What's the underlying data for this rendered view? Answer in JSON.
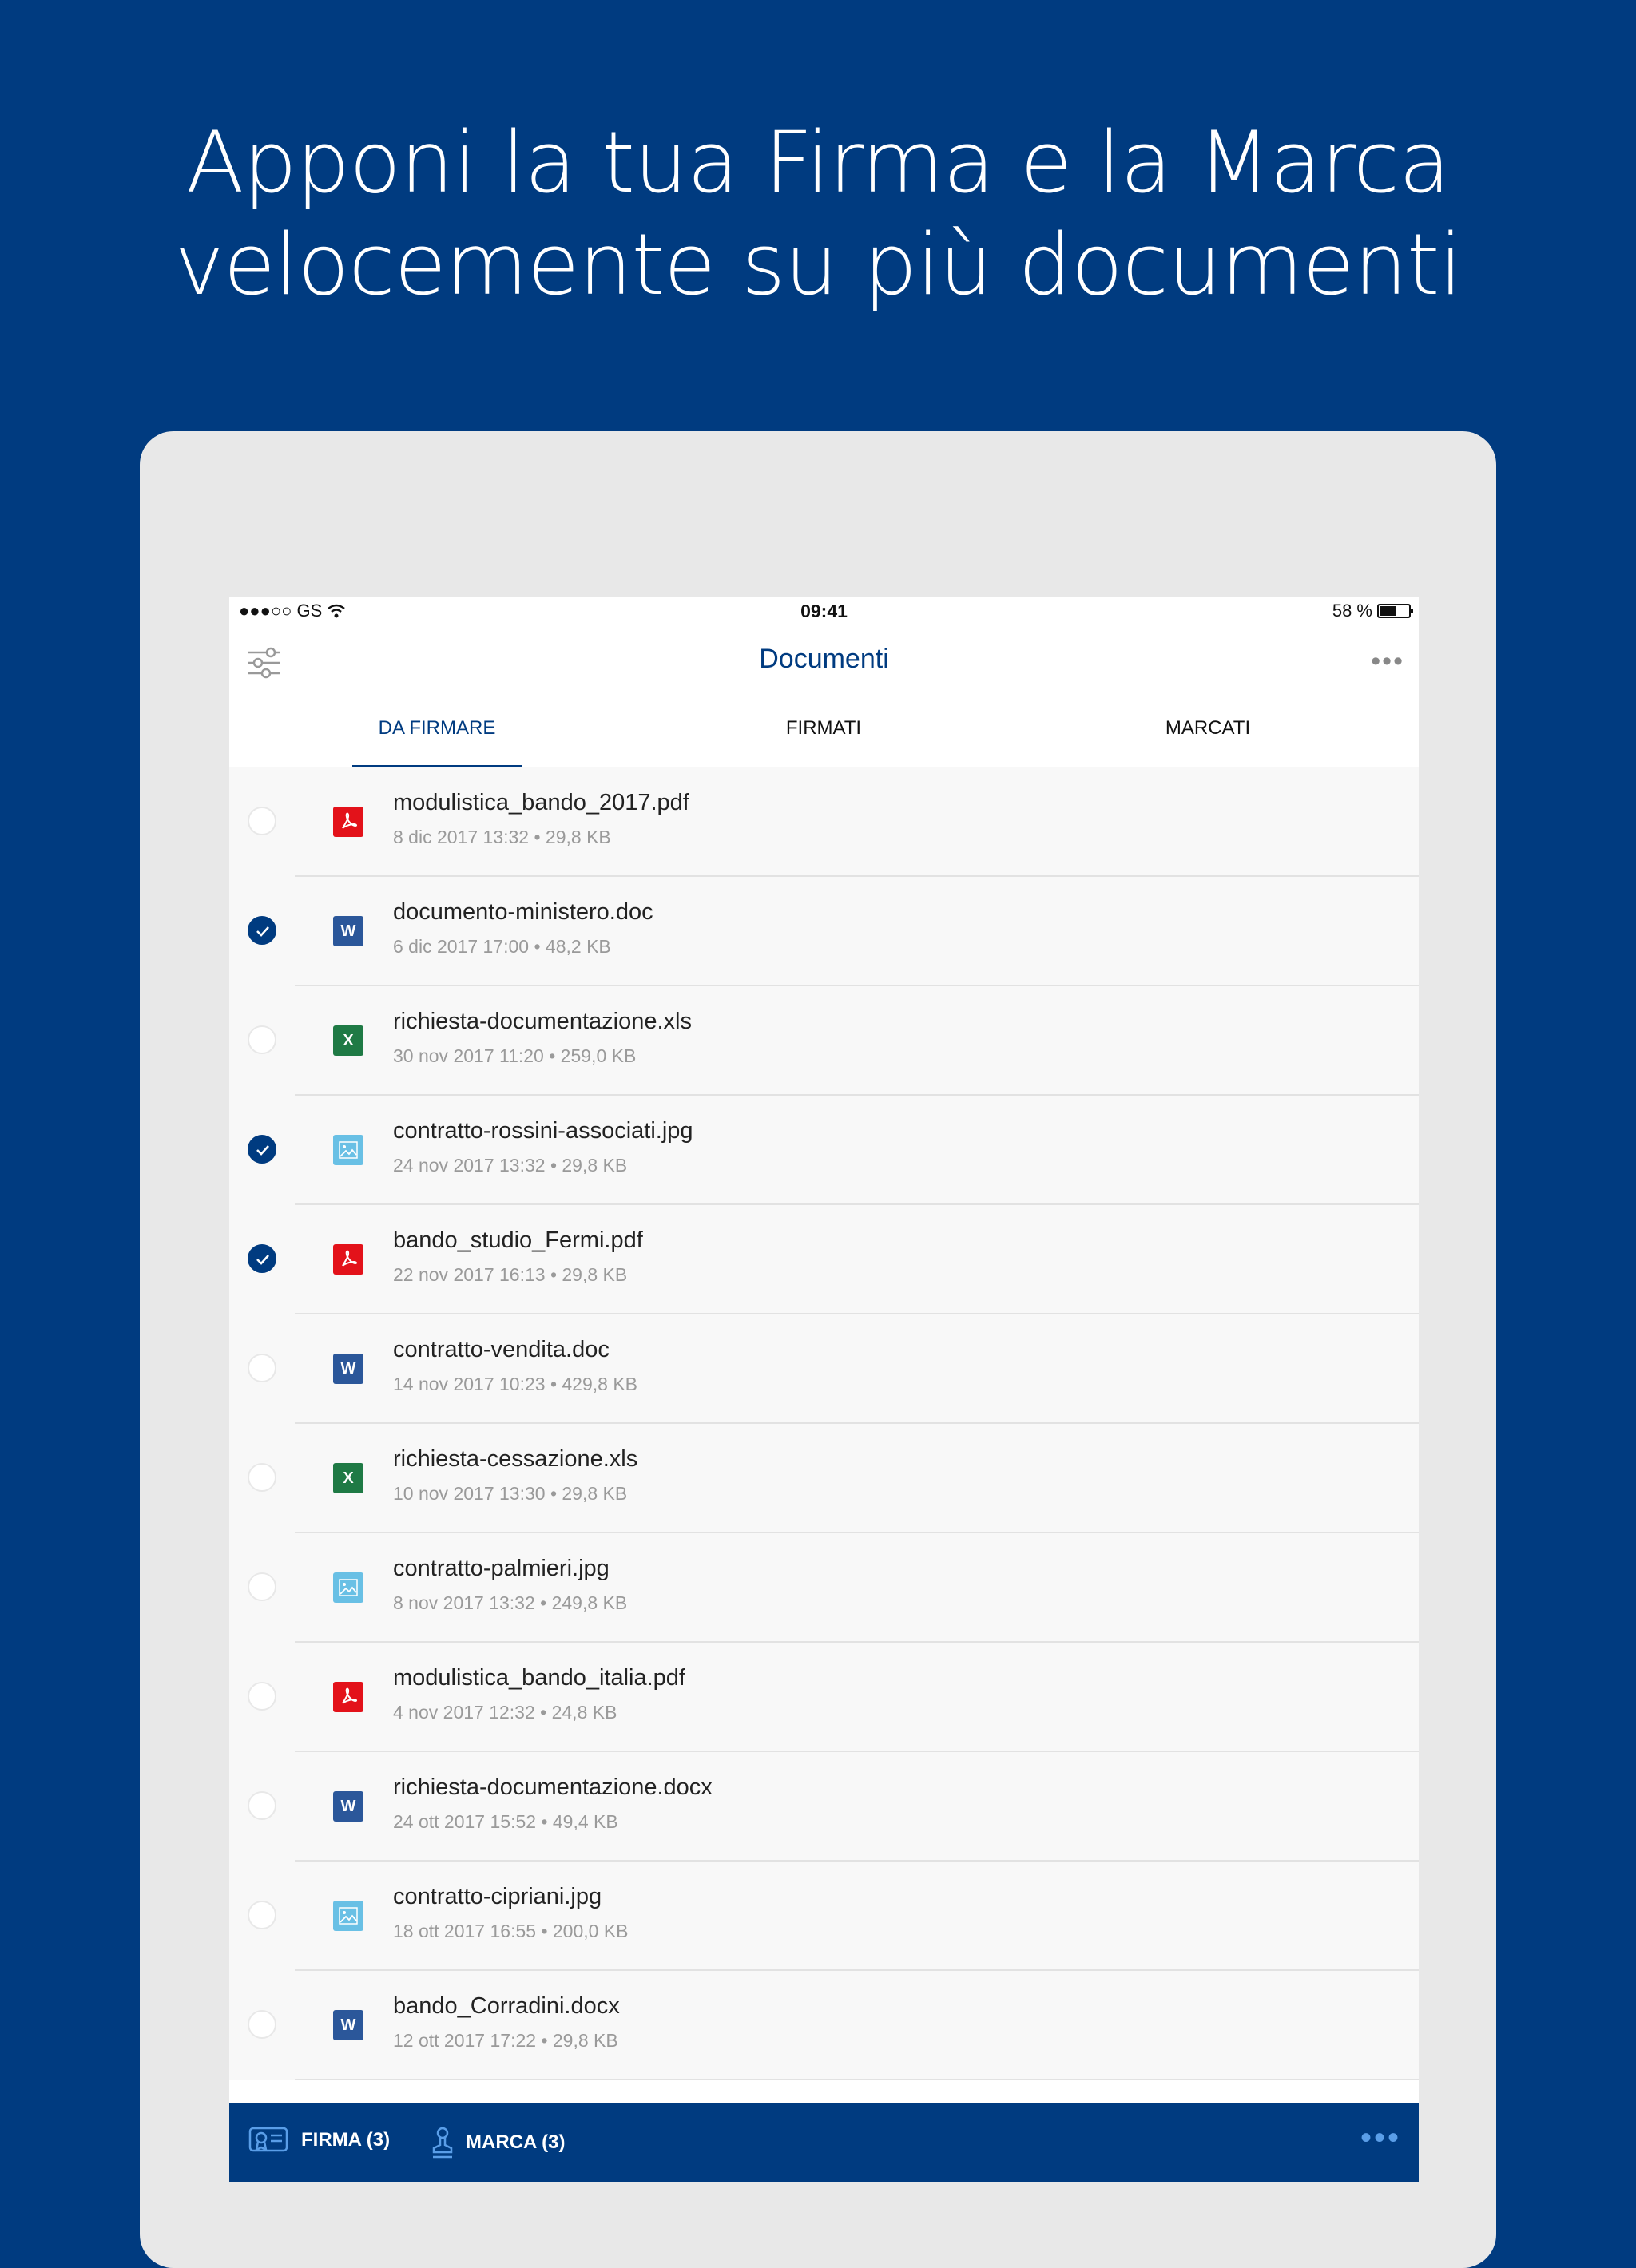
{
  "headline": {
    "line1": "Apponi la tua Firma e la Marca",
    "line2": "velocemente su più documenti"
  },
  "status_bar": {
    "carrier": "●●●○○ GS",
    "time": "09:41",
    "battery": "58 %",
    "battery_level": 0.58
  },
  "nav": {
    "title": "Documenti",
    "filter_icon": "filter-sliders-icon",
    "more_icon": "more-dots-icon"
  },
  "tabs": [
    {
      "label": "DA FIRMARE",
      "active": true
    },
    {
      "label": "FIRMATI",
      "active": false
    },
    {
      "label": "MARCATI",
      "active": false
    }
  ],
  "documents": [
    {
      "name": "modulistica_bando_2017.pdf",
      "meta": "8 dic 2017 13:32 • 29,8 KB",
      "type": "pdf",
      "checked": false
    },
    {
      "name": "documento-ministero.doc",
      "meta": "6 dic 2017 17:00 • 48,2 KB",
      "type": "doc",
      "checked": true
    },
    {
      "name": "richiesta-documentazione.xls",
      "meta": "30 nov 2017 11:20 • 259,0 KB",
      "type": "xls",
      "checked": false
    },
    {
      "name": "contratto-rossini-associati.jpg",
      "meta": "24 nov 2017 13:32 • 29,8 KB",
      "type": "jpg",
      "checked": true
    },
    {
      "name": "bando_studio_Fermi.pdf",
      "meta": "22 nov 2017 16:13 • 29,8 KB",
      "type": "pdf",
      "checked": true
    },
    {
      "name": "contratto-vendita.doc",
      "meta": "14 nov 2017 10:23 • 429,8 KB",
      "type": "doc",
      "checked": false
    },
    {
      "name": "richiesta-cessazione.xls",
      "meta": "10 nov 2017 13:30 • 29,8 KB",
      "type": "xls",
      "checked": false
    },
    {
      "name": "contratto-palmieri.jpg",
      "meta": "8 nov 2017 13:32 • 249,8 KB",
      "type": "jpg",
      "checked": false
    },
    {
      "name": "modulistica_bando_italia.pdf",
      "meta": "4 nov 2017 12:32 • 24,8 KB",
      "type": "pdf",
      "checked": false
    },
    {
      "name": "richiesta-documentazione.docx",
      "meta": "24 ott 2017 15:52 • 49,4 KB",
      "type": "doc",
      "checked": false
    },
    {
      "name": "contratto-cipriani.jpg",
      "meta": "18 ott 2017 16:55 • 200,0 KB",
      "type": "jpg",
      "checked": false
    },
    {
      "name": "bando_Corradini.docx",
      "meta": "12 ott 2017 17:22 • 29,8 KB",
      "type": "doc",
      "checked": false
    }
  ],
  "bottom_bar": {
    "firma_label": "FIRMA (3)",
    "marca_label": "MARCA  (3)",
    "firma_icon": "certificate-icon",
    "marca_icon": "stamp-icon",
    "more_icon": "more-dots-icon"
  },
  "colors": {
    "brand": "#003b80",
    "pdf": "#e3121a",
    "doc": "#2b579a",
    "xls": "#1f7a45",
    "jpg": "#69c0e5"
  }
}
